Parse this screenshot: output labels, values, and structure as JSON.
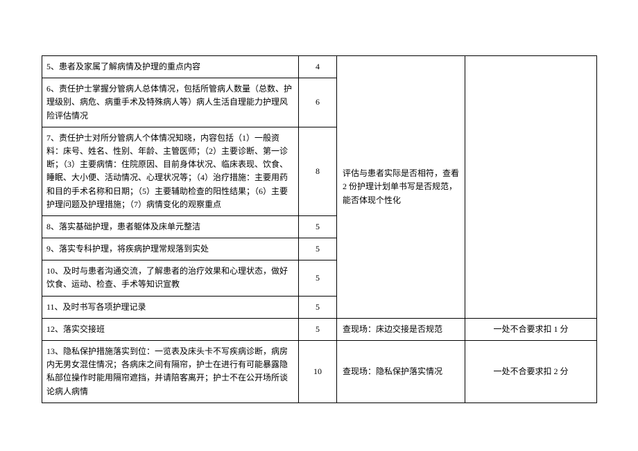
{
  "rows": [
    {
      "item": "5、患者及家属了解病情及护理的重点内容",
      "score": "4"
    },
    {
      "item": "6、责任护士掌握分管病人总体情况，包括所管病人数量（总数、护理级别、病危、病重手术及特殊病人等）病人生活自理能力护理风险评估情况",
      "score": "6"
    },
    {
      "item": "7、责任护士对所分管病人个体情况知晓，内容包括（1）一般资料：床号、姓名、性别、年龄、主管医师；（2）主要诊断、第一诊断；（3）主要病情：住院原因、目前身体状况、临床表现、饮食、睡眠、大小便、活动情况、心理状况等；（4）治疗措施：主要用药和目的手术名称和日期；（5）主要辅助检查的阳性结果；（6）主要护理问题及护理措施；（7）病情变化的观察重点",
      "score": "8"
    },
    {
      "item": "8、落实基础护理，患者躯体及床单元整洁",
      "score": "5"
    },
    {
      "item": "9、落实专科护理，将疾病护理常规落到实处",
      "score": "5"
    },
    {
      "item": "10、及时与患者沟通交流，了解患者的治疗效果和心理状态，做好饮食、运动、检查、手术等知识宣教",
      "score": "5"
    },
    {
      "item": "11、及时书写各项护理记录",
      "score": "5"
    },
    {
      "item": "12、落实交接班",
      "score": "5",
      "method": "查现场：床边交接是否规范",
      "deduct": "一处不合要求扣 1 分"
    },
    {
      "item": "13、隐私保护措施落实到位：一览表及床头卡不写疾病诊断，病房内无男女混住情况；各病床之间有隔帘，护士在进行有可能暴露隐私部位操作时能用隔帘遮挡，并请陪客离开；护士不在公开场所谈论病人病情",
      "score": "10",
      "method": "查现场：隐私保护落实情况",
      "deduct": "一处不合要求扣 2 分"
    }
  ],
  "merged": {
    "method_top": "评估与患者实际是否相符，查看 2 份护理计划单书写是否规范，能否体现个性化",
    "deduct_top": ""
  }
}
